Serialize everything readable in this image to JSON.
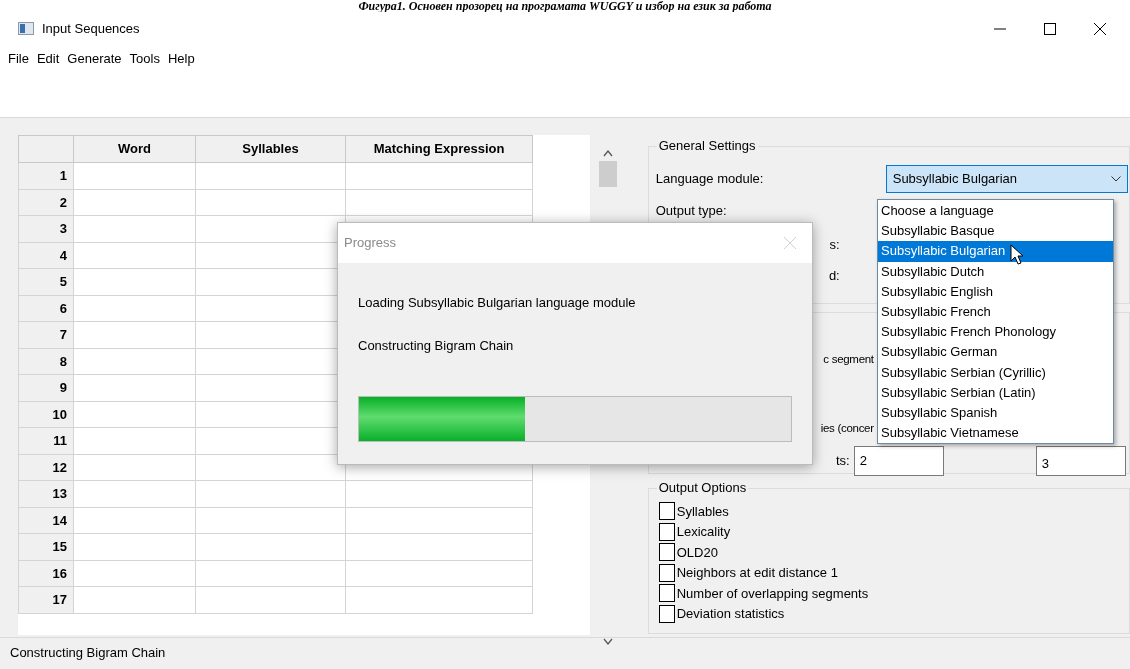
{
  "caption": "Фигура1. Основен прозорец на програмата WUGGY и избор на език за работа",
  "window": {
    "title": "Input Sequences"
  },
  "menu": [
    "File",
    "Edit",
    "Generate",
    "Tools",
    "Help"
  ],
  "table": {
    "columns": [
      "Word",
      "Syllables",
      "Matching Expression"
    ],
    "row_numbers": [
      "1",
      "2",
      "3",
      "4",
      "5",
      "6",
      "7",
      "8",
      "9",
      "10",
      "11",
      "12",
      "13",
      "14",
      "15",
      "16",
      "17"
    ]
  },
  "general_settings": {
    "title": "General Settings",
    "language_label": "Language module:",
    "language_value": "Subsyllabic Bulgarian",
    "output_type_label": "Output type:",
    "partial_labels": [
      "s:",
      "d:"
    ]
  },
  "segment_settings": {
    "partial_labels": [
      "c segment",
      "ies (concer"
    ],
    "overlap_label": "ts:",
    "overlap_value": "2",
    "out_of_value": "3"
  },
  "output_options": {
    "title": "Output Options",
    "items": [
      {
        "label": "Syllables",
        "checked": false
      },
      {
        "label": "Lexicality",
        "checked": false
      },
      {
        "label": "OLD20",
        "checked": false
      },
      {
        "label": "Neighbors at edit distance 1",
        "checked": false
      },
      {
        "label": "Number of overlapping segments",
        "checked": false
      },
      {
        "label": "Deviation statistics",
        "checked": false
      }
    ]
  },
  "language_dropdown": {
    "items": [
      {
        "label": "Choose a language",
        "selected": false
      },
      {
        "label": "Subsyllabic Basque",
        "selected": false
      },
      {
        "label": "Subsyllabic Bulgarian",
        "selected": true
      },
      {
        "label": "Subsyllabic Dutch",
        "selected": false
      },
      {
        "label": "Subsyllabic English",
        "selected": false
      },
      {
        "label": "Subsyllabic French",
        "selected": false
      },
      {
        "label": "Subsyllabic French Phonology",
        "selected": false
      },
      {
        "label": "Subsyllabic German",
        "selected": false
      },
      {
        "label": "Subsyllabic Serbian (Cyrillic)",
        "selected": false
      },
      {
        "label": "Subsyllabic Serbian (Latin)",
        "selected": false
      },
      {
        "label": "Subsyllabic Spanish",
        "selected": false
      },
      {
        "label": "Subsyllabic Vietnamese",
        "selected": false
      }
    ]
  },
  "progress_dialog": {
    "title": "Progress",
    "message": "Loading Subsyllabic Bulgarian language module",
    "step": "Constructing Bigram Chain",
    "level": 0.385
  },
  "status_bar": "Constructing Bigram Chain"
}
